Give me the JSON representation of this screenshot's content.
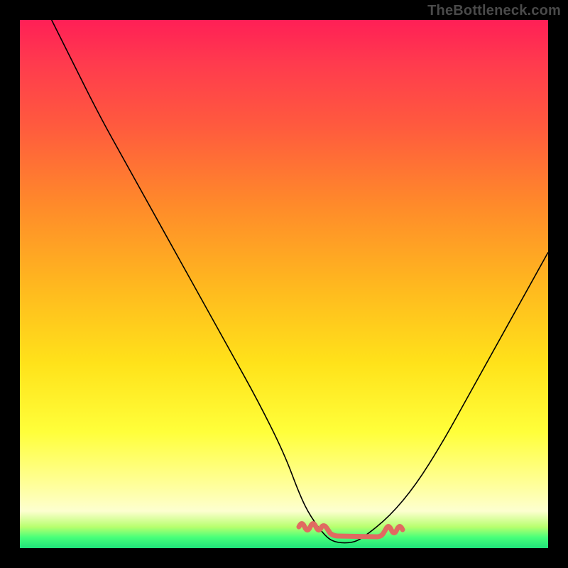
{
  "watermark": "TheBottleneck.com",
  "chart_data": {
    "type": "line",
    "title": "",
    "xlabel": "",
    "ylabel": "",
    "xlim": [
      0,
      100
    ],
    "ylim": [
      0,
      100
    ],
    "grid": false,
    "series": [
      {
        "name": "bottleneck-curve",
        "color": "#000000",
        "x": [
          6,
          10,
          15,
          20,
          25,
          30,
          35,
          40,
          45,
          50,
          53,
          55,
          58,
          60,
          63,
          65,
          70,
          75,
          80,
          85,
          90,
          95,
          100
        ],
        "y": [
          100,
          92,
          82,
          73,
          64,
          55,
          46,
          37,
          28,
          18,
          10,
          6,
          2,
          1,
          1,
          2,
          6,
          12,
          20,
          29,
          38,
          47,
          56
        ]
      }
    ],
    "annotations": [
      {
        "name": "optimal-region-scribble",
        "color": "#e06a61",
        "approx_x_range": [
          53,
          67
        ],
        "approx_y": 1
      }
    ],
    "background_gradient_stops": [
      {
        "pos": 0,
        "color": "#ff1f56"
      },
      {
        "pos": 50,
        "color": "#ffb71f"
      },
      {
        "pos": 78,
        "color": "#ffff3a"
      },
      {
        "pos": 96,
        "color": "#b7ff6e"
      },
      {
        "pos": 100,
        "color": "#20e27a"
      }
    ]
  }
}
